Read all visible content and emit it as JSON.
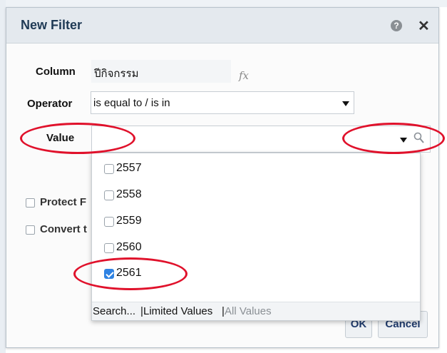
{
  "dialog": {
    "title": "New Filter",
    "help_icon": "help-icon",
    "close_icon": "close-icon",
    "close_glyph": "✕"
  },
  "form": {
    "column_label": "Column",
    "column_value": "ปีกิจกรรม",
    "fx_label": "fx",
    "operator_label": "Operator",
    "operator_value": "is equal to / is in",
    "value_label": "Value",
    "value_value": ""
  },
  "hidden_options": {
    "protect": "Protect F",
    "convert": "Convert t"
  },
  "dropdown": {
    "options": [
      {
        "label": "2557",
        "checked": false
      },
      {
        "label": "2558",
        "checked": false
      },
      {
        "label": "2559",
        "checked": false
      },
      {
        "label": "2560",
        "checked": false
      },
      {
        "label": "2561",
        "checked": true
      }
    ],
    "footer": {
      "search": "Search...",
      "sep1": "|",
      "limited": "Limited Values",
      "sep2": "|",
      "all": "All Values"
    }
  },
  "buttons": {
    "ok": "OK",
    "cancel": "Cancel"
  },
  "colors": {
    "annotation": "#e0112b",
    "checkbox_checked": "#2f83e3",
    "title_text": "#1f3a55"
  }
}
